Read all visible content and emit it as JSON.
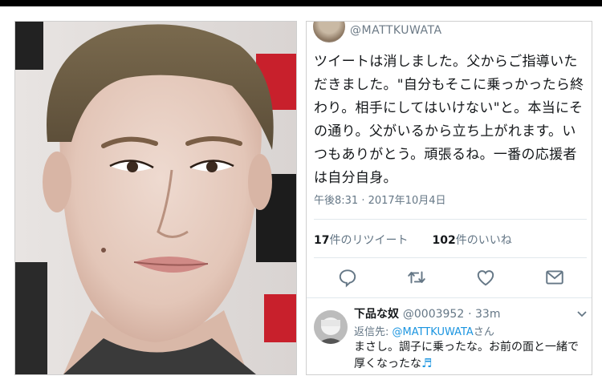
{
  "tweet": {
    "handle": "@MATTKUWATA",
    "body": "ツイートは消しました。父からご指導いただきました。\"自分もそこに乗っかったら終わり。相手にしてはいけない\"と。本当にその通り。父がいるから立ち上がれます。いつもありがとう。頑張るね。一番の応援者は自分自身。",
    "timestamp": "午後8:31 · 2017年10月4日",
    "retweet_count": "17",
    "retweet_label": "件のリツイート",
    "like_count": "102",
    "like_label": "件のいいね",
    "actions": [
      "reply-icon",
      "retweet-icon",
      "like-icon",
      "share-icon"
    ]
  },
  "reply": {
    "name": "下品な奴",
    "handle": "@0003952",
    "time": "33m",
    "reply_to_prefix": "返信先: ",
    "reply_to_handle": "@MATTKUWATA",
    "reply_to_suffix": "さん",
    "text": "まさし。調子に乗ったな。お前の面と一緒で厚くなったな",
    "emoji": "♬"
  },
  "colors": {
    "link": "#1b95e0",
    "muted": "#657786",
    "text": "#14171a",
    "background": "#000000"
  }
}
